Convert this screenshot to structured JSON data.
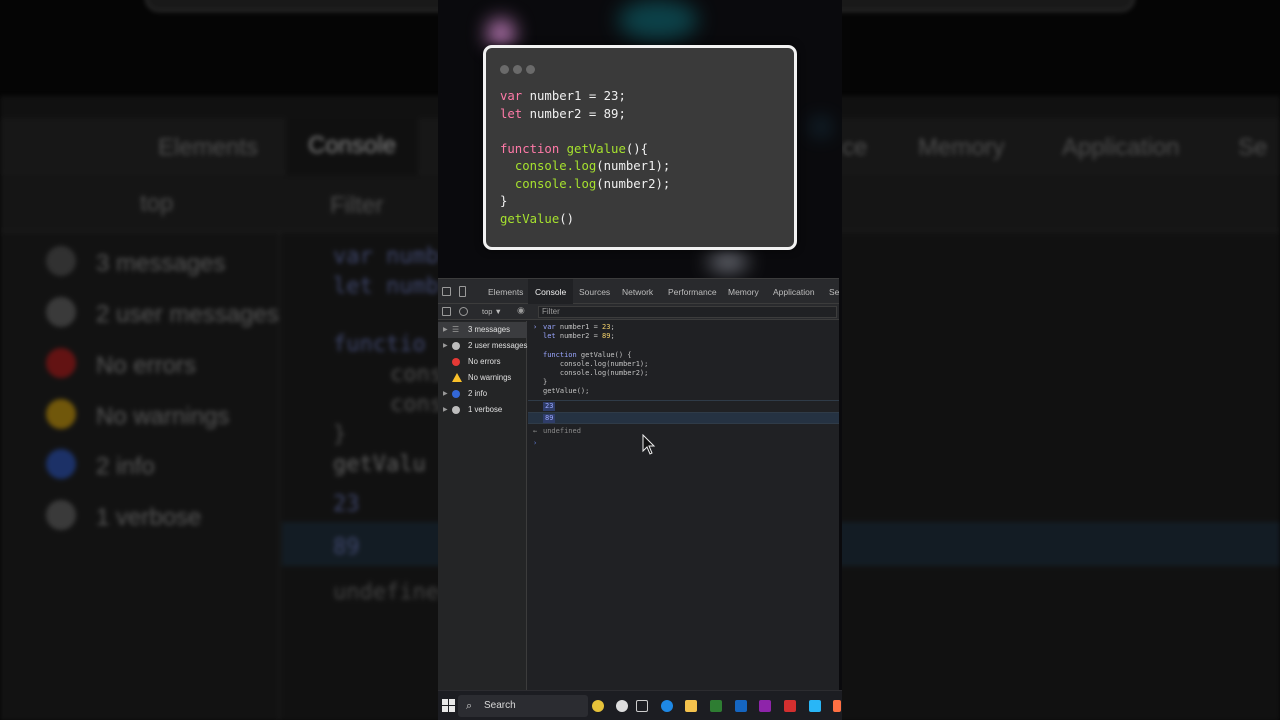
{
  "background": {
    "tabs": [
      "Elements",
      "Console",
      "ce",
      "Memory",
      "Application",
      "Se"
    ],
    "toolbar_scope": "top",
    "toolbar_filter": "Filter",
    "sidebar": [
      "3 messages",
      "2 user messages",
      "No errors",
      "No warnings",
      "2 info",
      "1 verbose"
    ],
    "code_lines": [
      "var numb",
      "let numb",
      "functio",
      "cons",
      "cons",
      "}",
      "getValu"
    ],
    "outputs": [
      "23",
      "89"
    ],
    "undefined": "undefined"
  },
  "card": {
    "code": {
      "line1_kw": "var",
      "line1_rest": " number1 = 23;",
      "line2_kw": "let",
      "line2_rest": " number2 = 89;",
      "line3_kw": "function",
      "line3_fn": "getValue",
      "line3_rest": "(){",
      "line4_fn": "console.log",
      "line4_rest": "(number1);",
      "line5_fn": "console.log",
      "line5_rest": "(number2);",
      "line6": "}",
      "line7_fn": "getValue",
      "line7_rest": "()"
    }
  },
  "devtools": {
    "tabs": {
      "elements": "Elements",
      "console": "Console",
      "sources": "Sources",
      "network": "Network",
      "performance": "Performance",
      "memory": "Memory",
      "application": "Application",
      "security": "Se"
    },
    "toolbar": {
      "scope": "top ▼",
      "filter_placeholder": "Filter"
    },
    "sidebar": [
      {
        "label": "3 messages",
        "icon": "list-icon",
        "color": "#9a9a9a"
      },
      {
        "label": "2 user messages",
        "icon": "user-icon",
        "color": "#bdbdbd"
      },
      {
        "label": "No errors",
        "icon": "error-icon",
        "color": "#e53935"
      },
      {
        "label": "No warnings",
        "icon": "warning-icon",
        "color": "#f9c02a"
      },
      {
        "label": "2 info",
        "icon": "info-icon",
        "color": "#3367d6"
      },
      {
        "label": "1 verbose",
        "icon": "bug-icon",
        "color": "#bdbdbd"
      }
    ],
    "console": {
      "input": {
        "l1a": "var",
        "l1b": " number1 = ",
        "l1c": "23",
        "l1d": ";",
        "l2a": "let",
        "l2b": " number2 = ",
        "l2c": "89",
        "l2d": ";",
        "l4a": "function",
        "l4b": " getValue() {",
        "l5": "    console.log(number1);",
        "l6": "    console.log(number2);",
        "l7": "}",
        "l8": "getValue();"
      },
      "outputs": [
        "23",
        "89"
      ],
      "return_value": "undefined"
    }
  },
  "taskbar": {
    "search_label": "Search"
  }
}
